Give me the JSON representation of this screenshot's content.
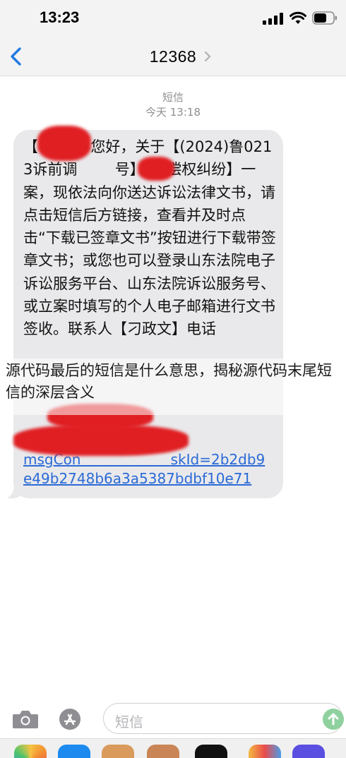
{
  "status_bar": {
    "time": "13:23"
  },
  "header": {
    "contact": "12368"
  },
  "meta": {
    "service": "短信",
    "timestamp": "今天 13:18"
  },
  "message": {
    "text": "【        】您好，关于【(2024)鲁0213诉前调        号】【追偿权纠纷】一案，现依法向你送达诉讼法律文书，请点击短信后方链接，查看并及时点击“下载已签章文书”按钮进行下载带签章文书；或您也可以登录山东法院电子诉讼服务平台、山东法院诉讼服务号、或立案时填写的个人电子邮箱进行文书签收。联系人【刁政文】电话",
    "link": "                    .do?\nmsgCon                    skId=2b2db9\ne49b2748b6a3a5387bdbf10e71"
  },
  "overlay": {
    "caption": "源代码最后的短信是什么意思，揭秘源代码末尾短信的深层含义"
  },
  "input": {
    "placeholder": "短信"
  },
  "colors": {
    "bubble": "#e9e9eb",
    "link": "#2a6ad6",
    "accent": "#1f7ae0",
    "redaction": "#e01f23",
    "send": "#8fd19e"
  }
}
